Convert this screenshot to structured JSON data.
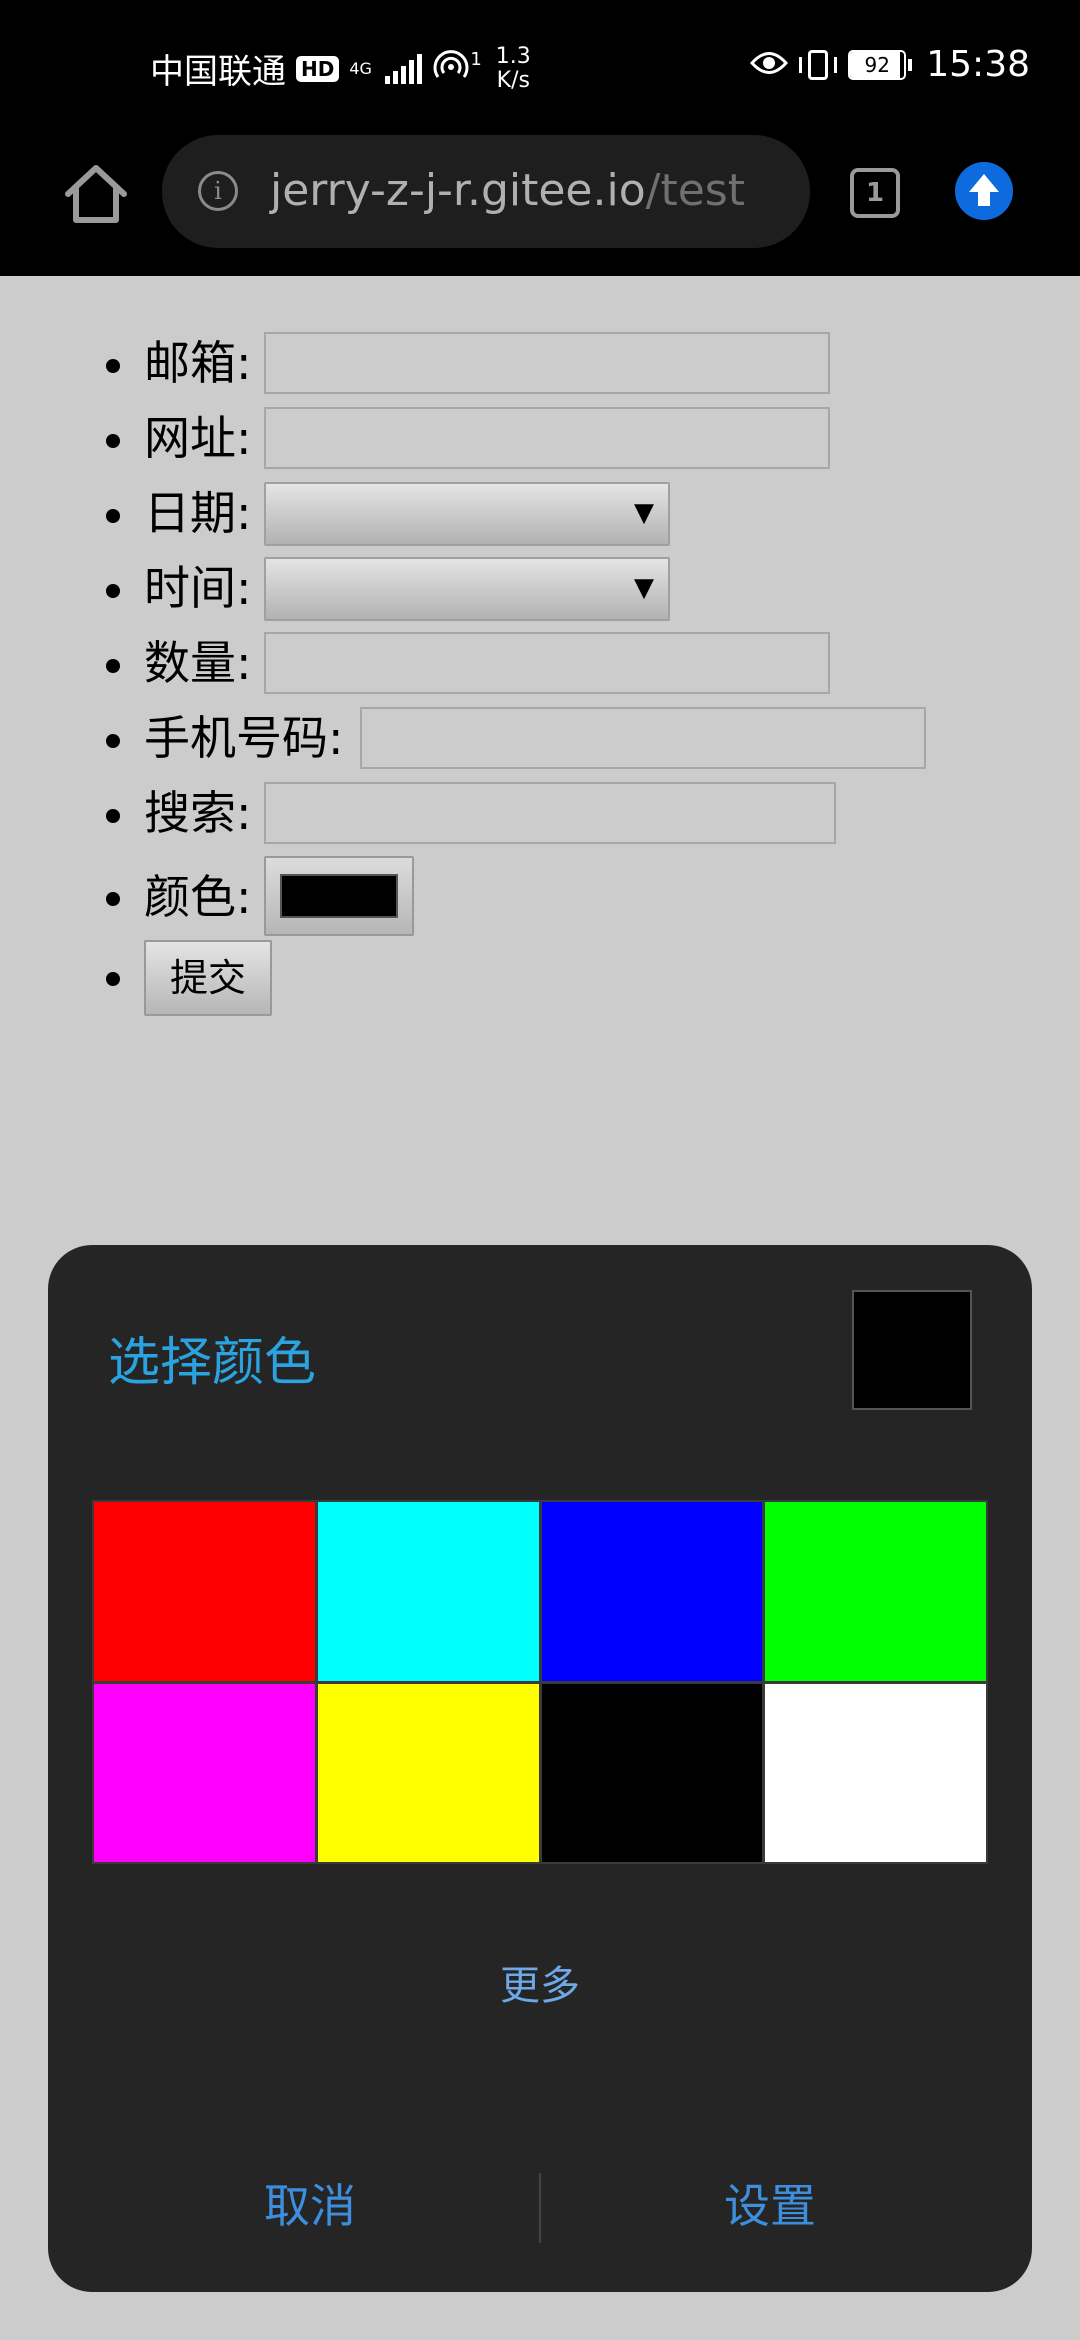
{
  "status_bar": {
    "carrier": "中国联通",
    "hd_badge": "HD",
    "network_type": "4G",
    "hotspot_count": "1",
    "speed_value": "1.3",
    "speed_unit": "K/s",
    "battery_percent": 92,
    "time": "15:38",
    "icons": [
      "hotspot-icon",
      "eye-comfort-icon",
      "vibrate-icon",
      "battery-icon"
    ]
  },
  "browser": {
    "url_host": "jerry-z-j-r.gitee.io",
    "url_path": "/test",
    "tab_count": "1",
    "icons": [
      "home-icon",
      "info-icon",
      "tabs-icon",
      "update-arrow-icon"
    ]
  },
  "form": {
    "email_label": "邮箱:",
    "url_label": "网址:",
    "date_label": "日期:",
    "date_value": "",
    "time_label": "时间:",
    "time_value": "",
    "number_label": "数量:",
    "phone_label": "手机号码:",
    "search_label": "搜索:",
    "color_label": "颜色:",
    "color_value": "#000000",
    "submit_label": "提交"
  },
  "color_dialog": {
    "title": "选择颜色",
    "selected_color": "#000000",
    "swatches": [
      "#ff0000",
      "#00ffff",
      "#0000ff",
      "#00ff00",
      "#ff00ff",
      "#ffff00",
      "#000000",
      "#ffffff"
    ],
    "more_label": "更多",
    "cancel_label": "取消",
    "set_label": "设置",
    "title_color": "#2aa3e0",
    "button_color": "#3d8fdd"
  }
}
